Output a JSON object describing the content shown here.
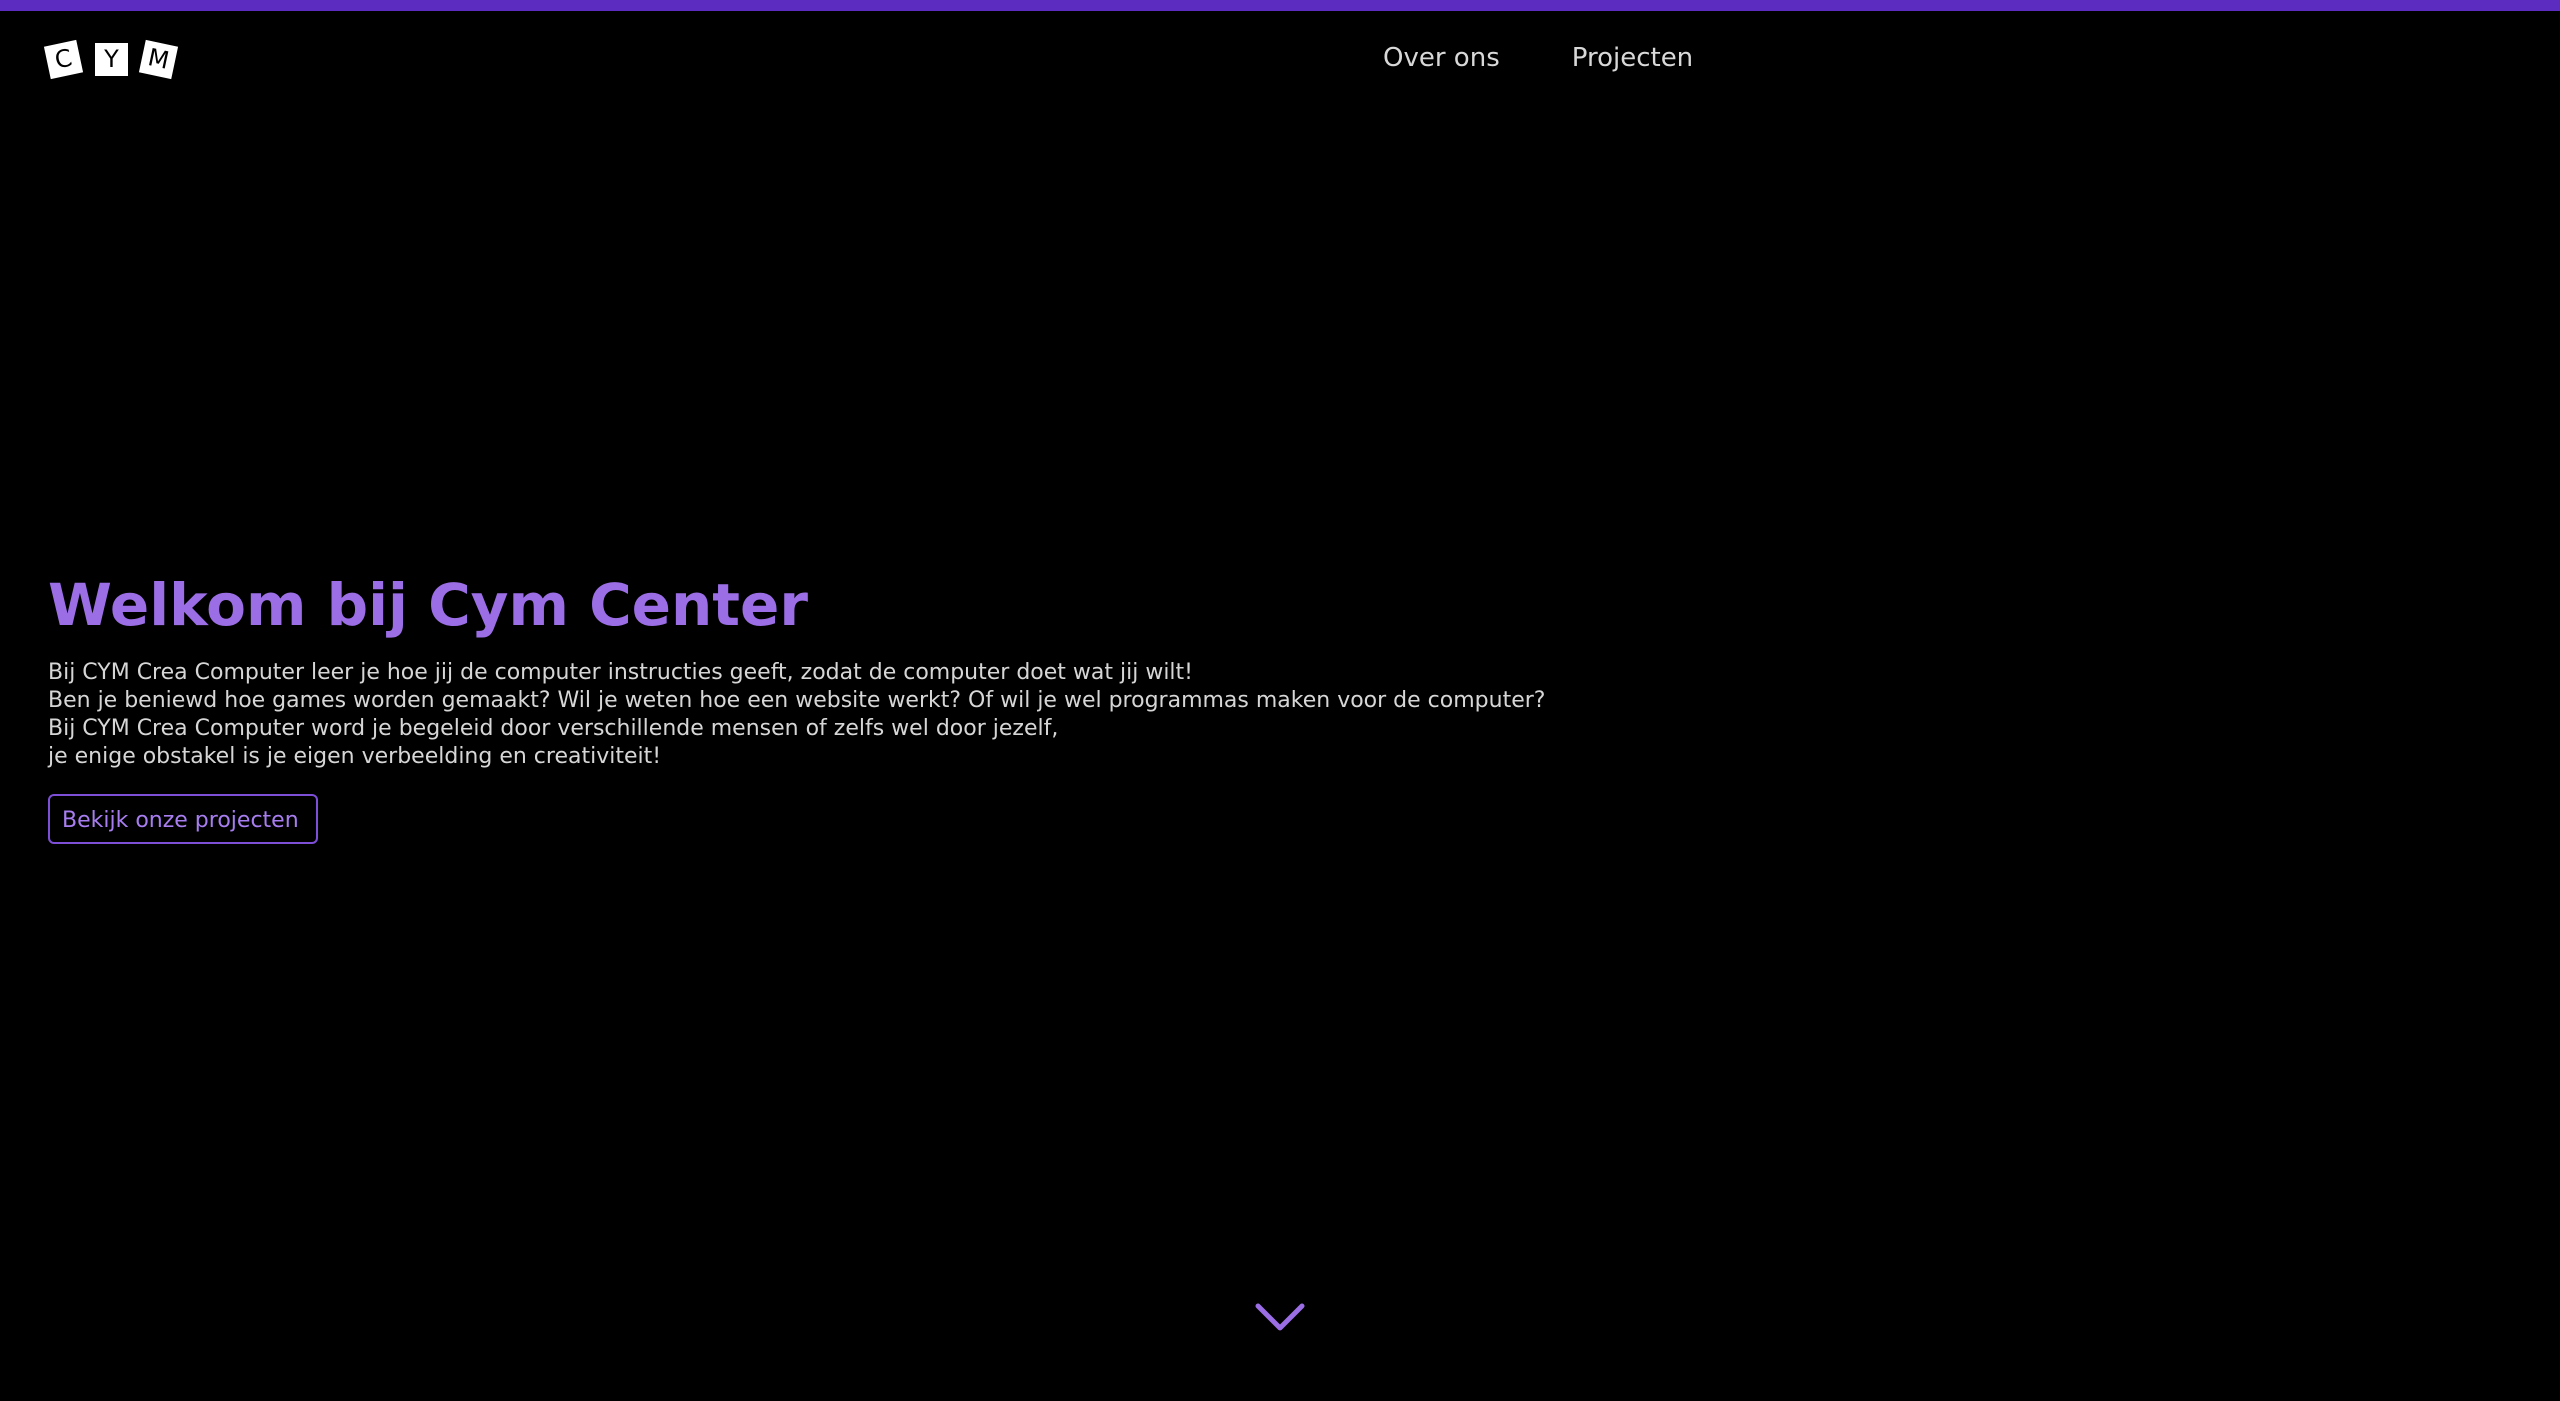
{
  "colors": {
    "accent": "#9b6ee6",
    "top_bar": "#5b2cbf",
    "background": "#000000",
    "text": "#d6d6d6"
  },
  "logo": {
    "letters": [
      "C",
      "Y",
      "M"
    ]
  },
  "nav": {
    "items": [
      {
        "label": "Over ons"
      },
      {
        "label": "Projecten"
      }
    ]
  },
  "hero": {
    "title": "Welkom bij Cym Center",
    "lines": [
      "Bij CYM Crea Computer leer je hoe jij de computer instructies geeft, zodat de computer doet wat jij wilt!",
      "Ben je beniewd hoe games worden gemaakt? Wil je weten hoe een website werkt? Of wil je wel programmas maken voor de computer?",
      "Bij CYM Crea Computer word je begeleid door verschillende mensen of zelfs wel door jezelf,",
      "je enige obstakel is je eigen verbeelding en creativiteit!"
    ],
    "cta_label": "Bekijk onze projecten"
  },
  "scroll_indicator": {
    "icon": "chevron-down-icon"
  }
}
